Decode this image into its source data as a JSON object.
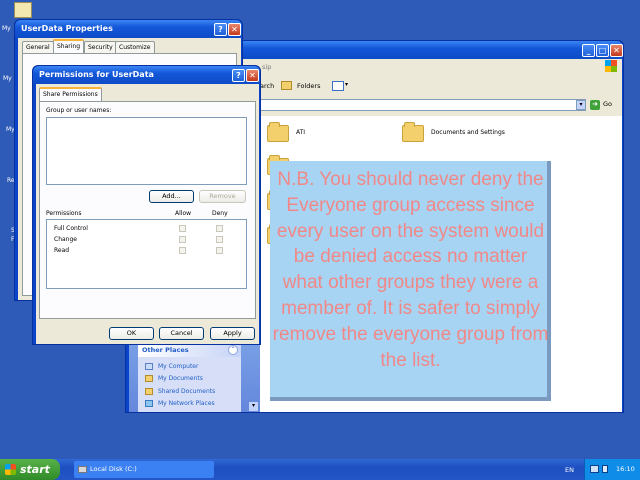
{
  "desktop": {
    "icon_labels": [
      "My",
      "My",
      "My",
      "Re",
      "S",
      "F"
    ]
  },
  "explorer": {
    "toolbar": {
      "search_partial": "arch",
      "folders_label": "Folders",
      "address_partial": "sip",
      "go_label": "Go"
    },
    "folders": [
      "ATI",
      "Documents and Settings"
    ],
    "other_places": {
      "title": "Other Places",
      "links": [
        "My Computer",
        "My Documents",
        "Shared Documents",
        "My Network Places"
      ]
    }
  },
  "properties_dialog": {
    "title": "UserData Properties",
    "tabs": [
      "General",
      "Sharing",
      "Security",
      "Customize"
    ],
    "help_glyph": "?",
    "close_glyph": "✕"
  },
  "permissions_dialog": {
    "title": "Permissions for UserData",
    "tab": "Share Permissions",
    "group_label": "Group or user names:",
    "add_button": "Add...",
    "remove_button": "Remove",
    "permissions_header": "Permissions",
    "allow_header": "Allow",
    "deny_header": "Deny",
    "permissions": [
      "Full Control",
      "Change",
      "Read"
    ],
    "ok_button": "OK",
    "cancel_button": "Cancel",
    "apply_button": "Apply",
    "help_glyph": "?",
    "close_glyph": "✕"
  },
  "note": {
    "text": "N.B. You should never deny the Everyone group access since every user on the system would be denied access no matter what other groups they were a member of.  It is safer to simply remove the everyone group from the list."
  },
  "taskbar": {
    "start_label": "start",
    "task_label": "Local Disk (C:)",
    "language": "EN",
    "clock": "16:10"
  },
  "colors": {
    "desktop": "#2e5bb8",
    "note_bg": "#a8d4f3",
    "note_text": "#f08888",
    "start_green": "#3f9d34"
  }
}
